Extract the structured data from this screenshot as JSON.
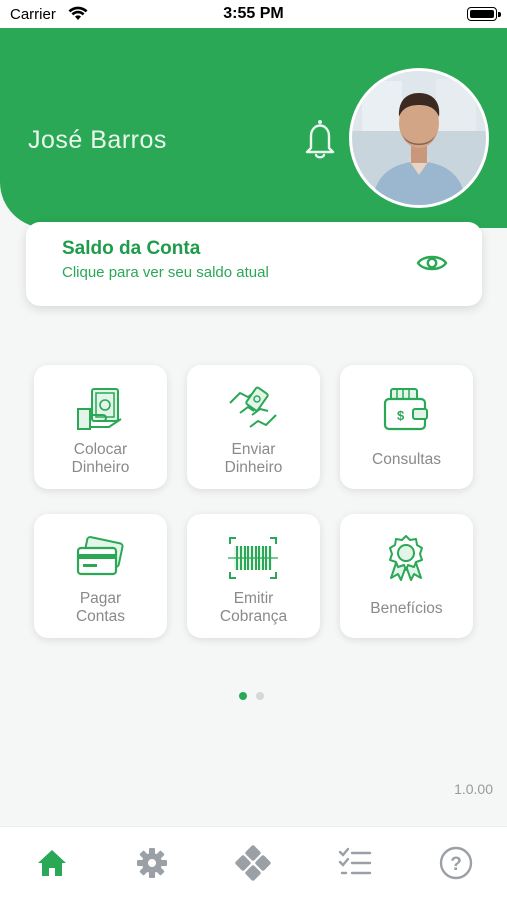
{
  "status_bar": {
    "carrier": "Carrier",
    "time": "3:55 PM"
  },
  "header": {
    "user_name": "José Barros"
  },
  "balance": {
    "title": "Saldo da Conta",
    "subtitle": "Clique para ver seu saldo atual"
  },
  "actions": [
    {
      "label": "Colocar\nDinheiro",
      "icon": "cash-deposit-icon"
    },
    {
      "label": "Enviar\nDinheiro",
      "icon": "money-transfer-icon"
    },
    {
      "label": "Consultas",
      "icon": "wallet-icon"
    },
    {
      "label": "Pagar\nContas",
      "icon": "credit-card-icon"
    },
    {
      "label": "Emitir\nCobrança",
      "icon": "barcode-icon"
    },
    {
      "label": "Benefícios",
      "icon": "award-badge-icon"
    }
  ],
  "pager": {
    "pages": 2,
    "active": 1
  },
  "version": "1.0.00",
  "tabbar": [
    {
      "name": "home",
      "icon": "home-icon",
      "active": true
    },
    {
      "name": "settings",
      "icon": "gear-icon",
      "active": false
    },
    {
      "name": "menu",
      "icon": "diamond-grid-icon",
      "active": false
    },
    {
      "name": "tasks",
      "icon": "checklist-icon",
      "active": false
    },
    {
      "name": "help",
      "icon": "help-icon",
      "active": false
    }
  ],
  "colors": {
    "primary": "#2aa855",
    "tile_label": "#8a8a8a",
    "inactive_icon": "#9aa0a6"
  }
}
